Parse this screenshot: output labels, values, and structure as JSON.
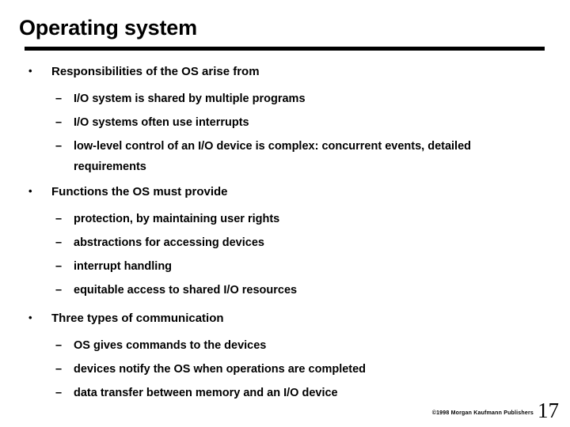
{
  "slide": {
    "title": "Operating system",
    "bullet_marker": "•",
    "dash_marker": "–",
    "groups": [
      {
        "heading": "Responsibilities of the OS arise from",
        "items": [
          "I/O system is shared by multiple programs",
          "I/O systems often use interrupts",
          "low-level control of an I/O device is complex: concurrent events, detailed requirements"
        ]
      },
      {
        "heading": "Functions the OS must provide",
        "items": [
          "protection, by maintaining user rights",
          "abstractions for accessing devices",
          "interrupt handling",
          "equitable access to shared I/O resources"
        ]
      },
      {
        "heading": "Three types of communication",
        "items": [
          "OS gives commands to the devices",
          "devices notify the OS when operations are completed",
          "data transfer between memory and an I/O device"
        ]
      }
    ]
  },
  "footer": {
    "copyright": "©1998 Morgan Kaufmann Publishers",
    "page_number": "17"
  },
  "colors": {
    "background": "#ffffff",
    "text": "#000000",
    "rule": "#000000"
  }
}
